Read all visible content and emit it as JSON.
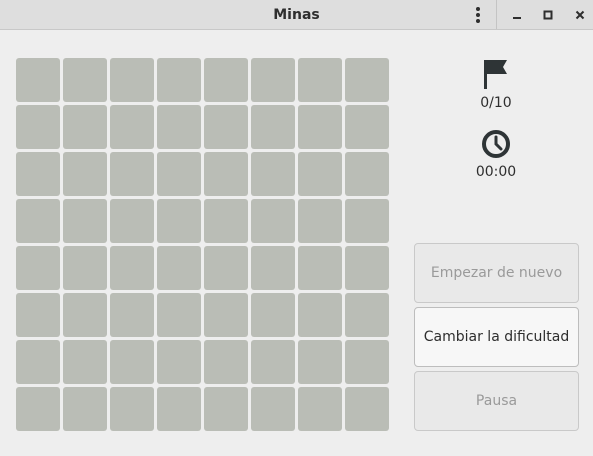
{
  "window": {
    "title": "Minas"
  },
  "titlebar": {
    "icons": [
      "menu-icon",
      "minimize-icon",
      "maximize-icon",
      "close-icon"
    ]
  },
  "board": {
    "rows": 8,
    "cols": 8,
    "cell_state": "covered",
    "cell_color": "#babdb6"
  },
  "status": {
    "mines_label": "0/10",
    "time_label": "00:00"
  },
  "buttons": {
    "restart_label": "Empezar de nuevo",
    "difficulty_label": "Cambiar la dificultad",
    "pause_label": "Pausa"
  },
  "colors": {
    "background": "#eeeeee",
    "titlebar": "#dedede",
    "text": "#2e2e2e",
    "disabled_text": "#9a9a9a"
  }
}
